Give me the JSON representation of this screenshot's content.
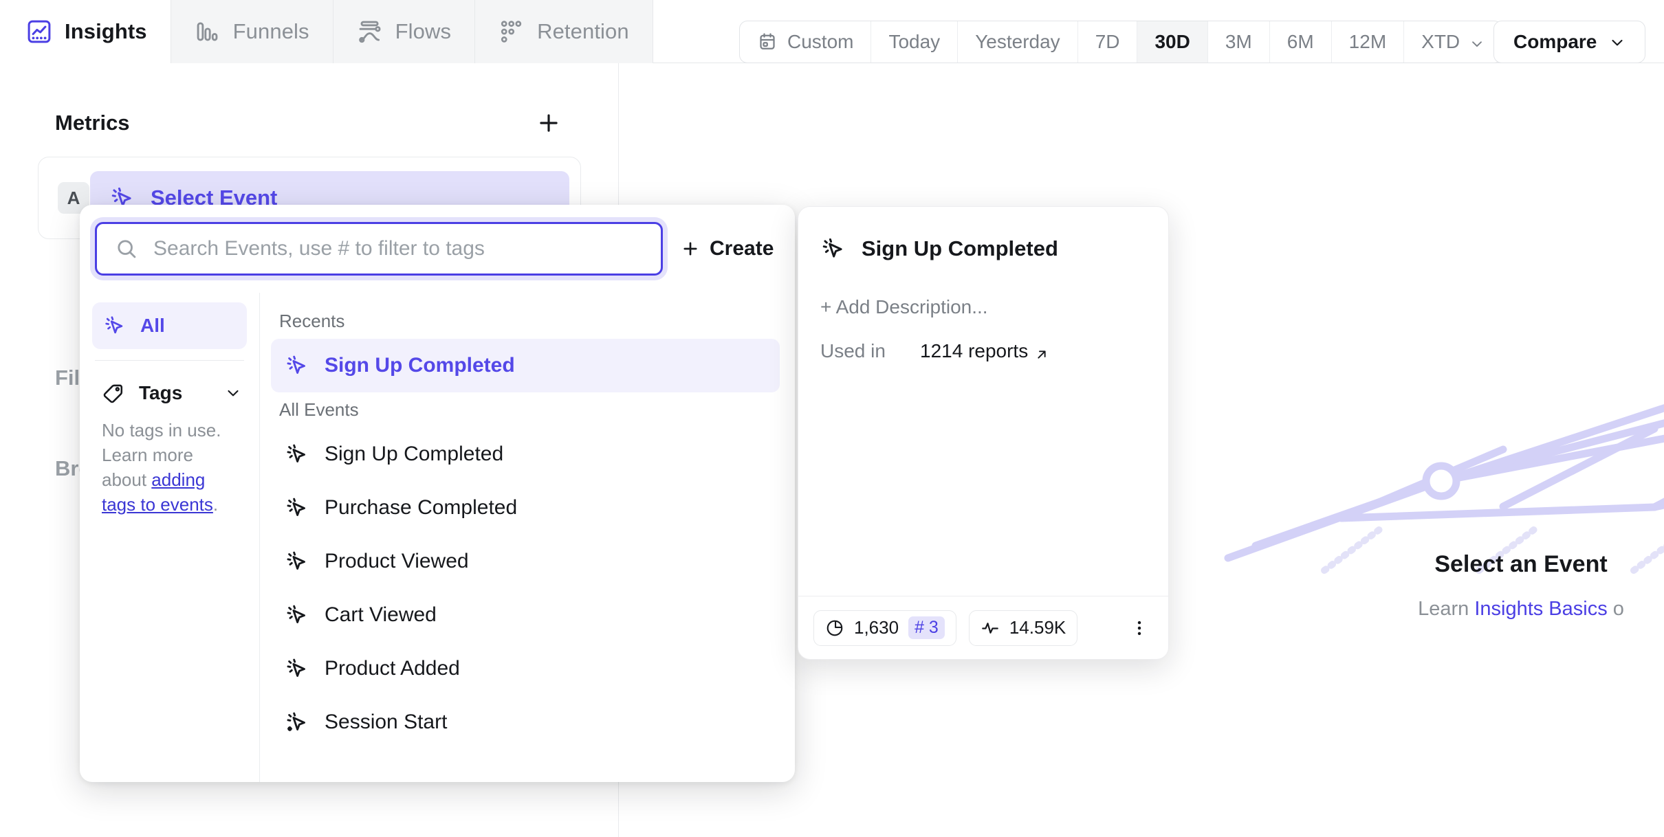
{
  "nav": {
    "tabs": [
      {
        "label": "Insights",
        "icon": "insights-chart-icon",
        "active": true
      },
      {
        "label": "Funnels",
        "icon": "funnels-bars-icon",
        "active": false
      },
      {
        "label": "Flows",
        "icon": "flows-path-icon",
        "active": false
      },
      {
        "label": "Retention",
        "icon": "retention-dots-icon",
        "active": false
      }
    ]
  },
  "daterange": {
    "items": [
      {
        "label": "Custom",
        "icon": "calendar-icon",
        "active": false
      },
      {
        "label": "Today",
        "icon": "",
        "active": false
      },
      {
        "label": "Yesterday",
        "icon": "",
        "active": false
      },
      {
        "label": "7D",
        "icon": "",
        "active": false
      },
      {
        "label": "30D",
        "icon": "",
        "active": true
      },
      {
        "label": "3M",
        "icon": "",
        "active": false
      },
      {
        "label": "6M",
        "icon": "",
        "active": false
      },
      {
        "label": "12M",
        "icon": "",
        "active": false
      },
      {
        "label": "XTD",
        "icon": "chevron-down-icon",
        "active": false
      }
    ],
    "compare_label": "Compare"
  },
  "left_panel": {
    "metrics_title": "Metrics",
    "add_metric_icon": "plus-icon",
    "metric": {
      "letter": "A",
      "select_event_label": "Select Event",
      "select_event_icon": "cursor-click-icon"
    },
    "filters_label": "Filters",
    "breakdown_label": "Breakdown"
  },
  "dropdown": {
    "search": {
      "placeholder": "Search Events, use # to filter to tags",
      "value": "",
      "icon": "search-icon"
    },
    "create_label": "Create",
    "create_icon": "plus-icon",
    "sidebar": {
      "all_label": "All",
      "all_icon": "cursor-click-icon",
      "tags_label": "Tags",
      "tags_icon": "tag-icon",
      "tags_chevron": "chevron-down-icon",
      "tags_note_prefix": "No tags in use. Learn more about ",
      "tags_note_link": "adding tags to events",
      "tags_note_suffix": "."
    },
    "groups": [
      {
        "label": "Recents",
        "items": [
          {
            "label": "Sign Up Completed",
            "icon": "cursor-click-icon",
            "selected": true
          }
        ]
      },
      {
        "label": "All Events",
        "items": [
          {
            "label": "Sign Up Completed",
            "icon": "cursor-click-icon",
            "selected": false
          },
          {
            "label": "Purchase Completed",
            "icon": "cursor-click-icon",
            "selected": false
          },
          {
            "label": "Product Viewed",
            "icon": "cursor-click-icon",
            "selected": false
          },
          {
            "label": "Cart Viewed",
            "icon": "cursor-click-icon",
            "selected": false
          },
          {
            "label": "Product Added",
            "icon": "cursor-click-icon",
            "selected": false
          },
          {
            "label": "Session Start",
            "icon": "cursor-click-star-icon",
            "selected": false
          }
        ]
      }
    ]
  },
  "detail_card": {
    "title": "Sign Up Completed",
    "title_icon": "cursor-click-icon",
    "add_description_label": "+ Add Description...",
    "used_in_label": "Used in",
    "used_in_value": "1214 reports",
    "used_in_arrow_icon": "arrow-up-right-icon",
    "stat_pie": {
      "icon": "pie-chart-icon",
      "value": "1,630",
      "rank": "# 3"
    },
    "stat_activity": {
      "icon": "activity-pulse-icon",
      "value": "14.59K"
    },
    "more_icon": "kebab-menu-icon"
  },
  "empty_state": {
    "title": "Select an Event",
    "sub_prefix": "Learn ",
    "sub_link": "Insights Basics",
    "sub_suffix": " o",
    "illustration_icon": "insights-grid-illustration"
  },
  "colors": {
    "accent": "#4b3fe4",
    "accent_text": "#5448e8",
    "accent_soft_bg": "#e2e0fb",
    "accent_faint_bg": "#f2f1fd",
    "text": "#16181c",
    "muted": "#8b9096",
    "border": "#e9ebed",
    "panel_bg": "#f4f5f6",
    "illustration": "#d3d1f7"
  }
}
